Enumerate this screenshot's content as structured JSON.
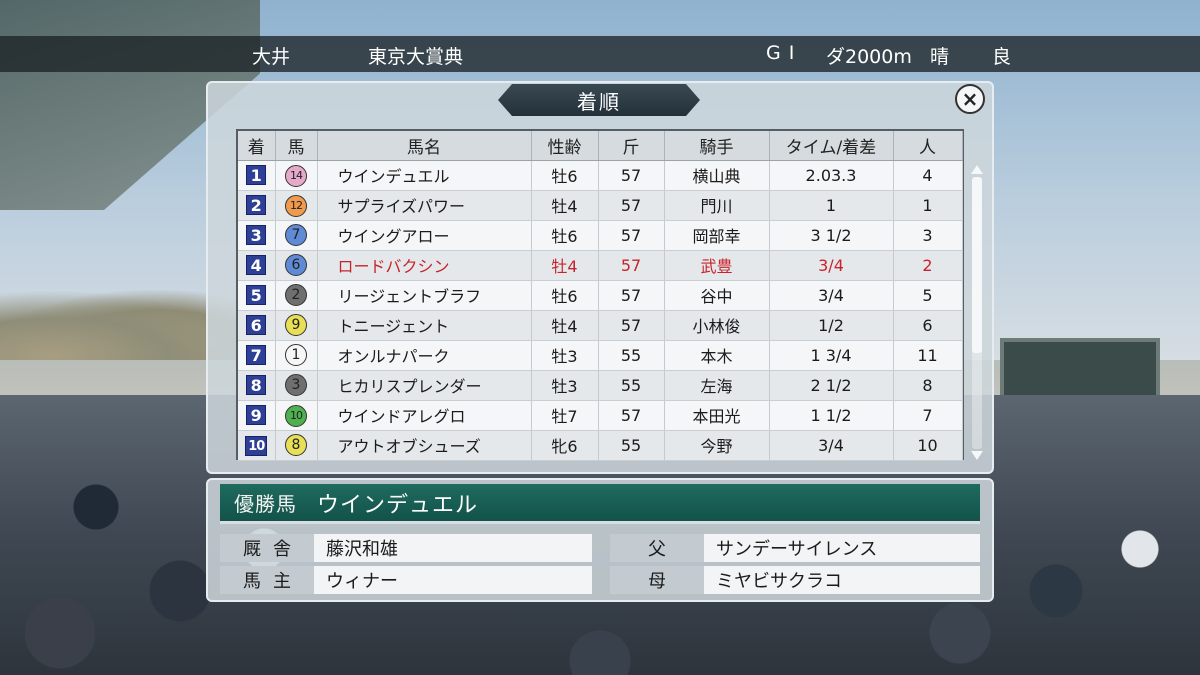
{
  "race_header": {
    "venue": "大井",
    "race_name": "東京大賞典",
    "grade": "GI",
    "distance": "ダ2000m",
    "weather": "晴",
    "track_condition": "良"
  },
  "results_panel": {
    "title": "着順",
    "close_label": "×",
    "columns": [
      "着",
      "馬",
      "馬名",
      "性齢",
      "斤",
      "騎手",
      "タイム/着差",
      "人"
    ],
    "rows": [
      {
        "pos": "1",
        "num": "14",
        "num_color": "#e7a9c9",
        "name": "ウインデュエル",
        "sex_age": "牡6",
        "weight": "57",
        "jockey": "横山典",
        "margin": "2.03.3",
        "pop": "4"
      },
      {
        "pos": "2",
        "num": "12",
        "num_color": "#ef9a4c",
        "name": "サプライズパワー",
        "sex_age": "牡4",
        "weight": "57",
        "jockey": "門川",
        "margin": "1",
        "pop": "1"
      },
      {
        "pos": "3",
        "num": "7",
        "num_color": "#5f8ad6",
        "name": "ウイングアロー",
        "sex_age": "牡6",
        "weight": "57",
        "jockey": "岡部幸",
        "margin": "3 1/2",
        "pop": "3"
      },
      {
        "pos": "4",
        "num": "6",
        "num_color": "#5f8ad6",
        "name": "ロードバクシン",
        "sex_age": "牡4",
        "weight": "57",
        "jockey": "武豊",
        "margin": "3/4",
        "pop": "2"
      },
      {
        "pos": "5",
        "num": "2",
        "num_color": "#6f6f6f",
        "name": "リージェントブラフ",
        "sex_age": "牡6",
        "weight": "57",
        "jockey": "谷中",
        "margin": "3/4",
        "pop": "5"
      },
      {
        "pos": "6",
        "num": "9",
        "num_color": "#e8df56",
        "name": "トニージェント",
        "sex_age": "牡4",
        "weight": "57",
        "jockey": "小林俊",
        "margin": "1/2",
        "pop": "6"
      },
      {
        "pos": "7",
        "num": "1",
        "num_color": "#f6f6f6",
        "name": "オンルナパーク",
        "sex_age": "牡3",
        "weight": "55",
        "jockey": "本木",
        "margin": "1 3/4",
        "pop": "11"
      },
      {
        "pos": "8",
        "num": "3",
        "num_color": "#6f6f6f",
        "name": "ヒカリスプレンダー",
        "sex_age": "牡3",
        "weight": "55",
        "jockey": "左海",
        "margin": "2 1/2",
        "pop": "8"
      },
      {
        "pos": "9",
        "num": "10",
        "num_color": "#4fb04f",
        "name": "ウインドアレグロ",
        "sex_age": "牡7",
        "weight": "57",
        "jockey": "本田光",
        "margin": "1 1/2",
        "pop": "7"
      },
      {
        "pos": "10",
        "num": "8",
        "num_color": "#e8df56",
        "name": "アウトオブシューズ",
        "sex_age": "牝6",
        "weight": "55",
        "jockey": "今野",
        "margin": "3/4",
        "pop": "10"
      }
    ],
    "highlight_row_index": 3,
    "highlight_color": "#c8232c"
  },
  "winner": {
    "label": "優勝馬",
    "name": "ウインデュエル",
    "stable_label": "厩舎",
    "stable": "藤沢和雄",
    "owner_label": "馬主",
    "owner": "ウィナー",
    "sire_label": "父",
    "sire": "サンデーサイレンス",
    "dam_label": "母",
    "dam": "ミヤビサクラコ"
  }
}
